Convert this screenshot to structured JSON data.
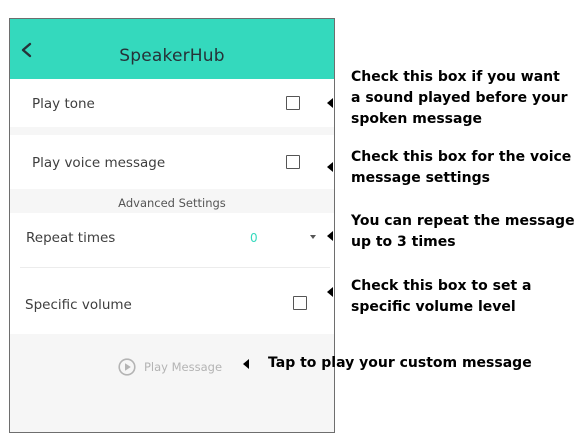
{
  "header": {
    "title": "SpeakerHub",
    "back_icon": "chevron-left-icon",
    "bg_color": "#34d9bd"
  },
  "settings": {
    "play_tone": {
      "label": "Play tone",
      "checked": false
    },
    "play_voice_message": {
      "label": "Play voice message",
      "checked": false
    },
    "advanced_label": "Advanced Settings",
    "repeat_times": {
      "label": "Repeat times",
      "value": "0",
      "value_color": "#34d9bd"
    },
    "specific_volume": {
      "label": "Specific volume",
      "checked": false
    }
  },
  "play_message": {
    "label": "Play Message",
    "icon": "play-circle-icon"
  },
  "callouts": [
    {
      "lines": [
        "Check this box if you want",
        "a sound played before your",
        "spoken message"
      ]
    },
    {
      "lines": [
        "Check this box for the voice",
        "message settings"
      ]
    },
    {
      "lines": [
        "You can repeat the message",
        "up to 3 times"
      ]
    },
    {
      "lines": [
        "Check this box to set a",
        "specific volume level"
      ]
    },
    {
      "lines": [
        "Tap to play your custom message"
      ]
    }
  ]
}
